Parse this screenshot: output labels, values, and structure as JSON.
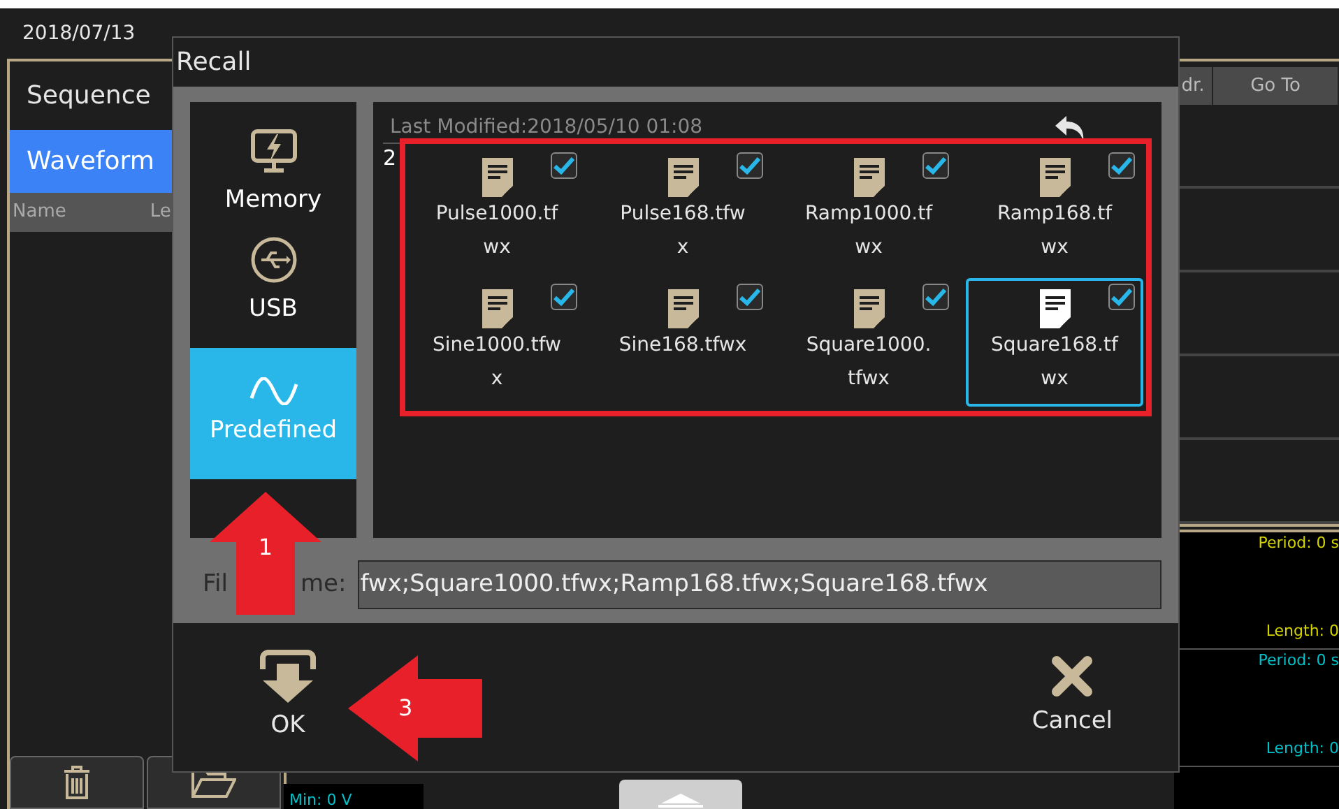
{
  "date": "2018/07/13",
  "side_tabs": [
    {
      "label": "Sequence",
      "selected": false
    },
    {
      "label": "Waveform",
      "selected": true
    }
  ],
  "list_header": [
    "Name",
    "Le"
  ],
  "table_columns": [
    "dr.",
    "Go To"
  ],
  "channels": [
    {
      "period": "Period: 0 s",
      "length": "Length: 0",
      "color": "#d4d400"
    },
    {
      "period": "Period: 0 s",
      "length": "Length: 0",
      "color": "#00c0c8"
    }
  ],
  "min_reading": "Min: 0 V",
  "dialog": {
    "title": "Recall",
    "sources": [
      {
        "label": "Memory",
        "kind": "memory",
        "selected": false
      },
      {
        "label": "USB",
        "kind": "usb",
        "selected": false
      },
      {
        "label": "Predefined",
        "kind": "predefined",
        "selected": true
      }
    ],
    "last_modified": "Last Modified:2018/05/10 01:08",
    "cut_text": "2",
    "files": [
      {
        "name": "Pulse1000.tfwx",
        "checked": true,
        "selected": false
      },
      {
        "name": "Pulse168.tfwx",
        "checked": true,
        "selected": false
      },
      {
        "name": "Ramp1000.tfwx",
        "checked": true,
        "selected": false
      },
      {
        "name": "Ramp168.tfwx",
        "checked": true,
        "selected": false
      },
      {
        "name": "Sine1000.tfwx",
        "checked": true,
        "selected": false
      },
      {
        "name": "Sine168.tfwx",
        "checked": true,
        "selected": false
      },
      {
        "name": "Square1000.tfwx",
        "checked": true,
        "selected": false
      },
      {
        "name": "Square168.tfwx",
        "checked": true,
        "selected": true
      }
    ],
    "file_name_label_parts": [
      "Fil",
      "me:"
    ],
    "file_name_value": "fwx;Square1000.tfwx;Ramp168.tfwx;Square168.tfwx",
    "ok": "OK",
    "cancel": "Cancel"
  },
  "annotations": [
    {
      "label": "1",
      "kind": "up"
    },
    {
      "label": "3",
      "kind": "left"
    }
  ]
}
